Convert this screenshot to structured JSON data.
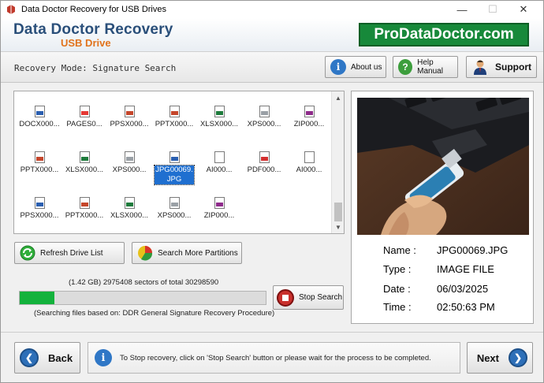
{
  "window": {
    "title": "Data Doctor Recovery for USB Drives",
    "min": "—",
    "max": "☐",
    "close": "✕"
  },
  "header": {
    "brand_main": "Data Doctor Recovery",
    "brand_sub": "USB Drive",
    "site": "ProDataDoctor.com"
  },
  "modebar": {
    "mode_text": "Recovery Mode: Signature Search",
    "about_label": "About us",
    "help_label": "Help Manual",
    "support_label": "Support"
  },
  "files": [
    {
      "name": "DOCX000...",
      "type": "docx",
      "color": "#2b5fb0"
    },
    {
      "name": "PAGES0...",
      "type": "pages",
      "color": "#e53935"
    },
    {
      "name": "PPSX000...",
      "type": "ppsx",
      "color": "#c5462b"
    },
    {
      "name": "PPTX000...",
      "type": "pptx",
      "color": "#c5462b"
    },
    {
      "name": "XLSX000...",
      "type": "xlsx",
      "color": "#1e7b3c"
    },
    {
      "name": "XPS000...",
      "type": "xps",
      "color": "#9aa0a6"
    },
    {
      "name": "ZIP000...",
      "type": "zip",
      "color": "#8e2b8a"
    },
    {
      "name": "PPTX000...",
      "type": "pptx",
      "color": "#c5462b"
    },
    {
      "name": "XLSX000...",
      "type": "xlsx",
      "color": "#1e7b3c"
    },
    {
      "name": "XPS000...",
      "type": "xps",
      "color": "#9aa0a6"
    },
    {
      "name": "JPG00069.\nJPG",
      "type": "jpg",
      "color": "#2b5fb0",
      "selected": true
    },
    {
      "name": "AI000...",
      "type": "ai",
      "color": "#ffffff"
    },
    {
      "name": "PDF000...",
      "type": "pdf",
      "color": "#d32f2f"
    },
    {
      "name": "AI000...",
      "type": "ai",
      "color": "#ffffff"
    },
    {
      "name": "PPSX000...",
      "type": "ppsx",
      "color": "#2b5fb0"
    },
    {
      "name": "PPTX000...",
      "type": "pptx",
      "color": "#c5462b"
    },
    {
      "name": "XLSX000...",
      "type": "xlsx",
      "color": "#1e7b3c"
    },
    {
      "name": "XPS000...",
      "type": "xps",
      "color": "#9aa0a6"
    },
    {
      "name": "ZIP000...",
      "type": "zip",
      "color": "#8e2b8a"
    }
  ],
  "actions": {
    "refresh_label": "Refresh Drive List",
    "partitions_label": "Search More Partitions",
    "stop_label": "Stop Search"
  },
  "progress": {
    "sector_text": "(1.42 GB) 2975408  sectors  of  total 30298590",
    "fraction": 0.14,
    "search_note": "(Searching files based on:  DDR General Signature Recovery Procedure)"
  },
  "preview": {
    "name_key": "Name :",
    "name_val": "JPG00069.JPG",
    "type_key": "Type :",
    "type_val": "IMAGE FILE",
    "date_key": "Date :",
    "date_val": "06/03/2025",
    "time_key": "Time :",
    "time_val": "02:50:63  PM"
  },
  "footer": {
    "back_label": "Back",
    "next_label": "Next",
    "status_text": "To Stop recovery, click on 'Stop Search' button or please wait for the process to be completed."
  },
  "colors": {
    "brand": "#2a4f7a",
    "accent": "#e1731c",
    "badge": "#17893a",
    "progress": "#13b23c"
  }
}
